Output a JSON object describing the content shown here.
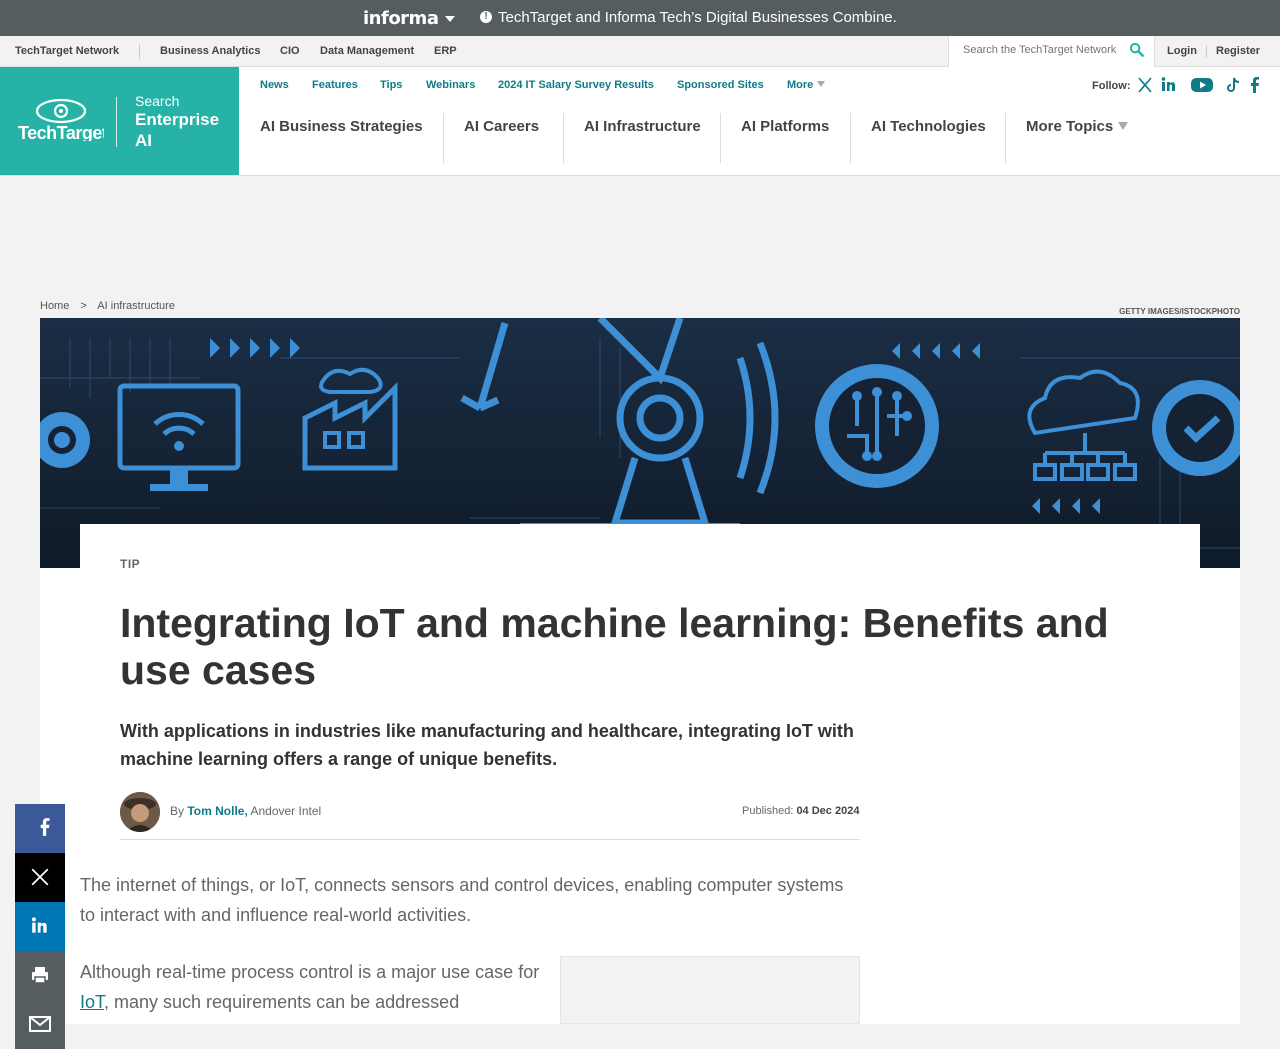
{
  "informa_bar": {
    "logo": "informa",
    "message": "TechTarget and Informa Tech’s Digital Businesses Combine."
  },
  "network_bar": {
    "network_label": "TechTarget Network",
    "links": [
      "Business Analytics",
      "CIO",
      "Data Management",
      "ERP"
    ],
    "search_placeholder": "Search the TechTarget Network",
    "login": "Login",
    "register": "Register"
  },
  "brand": {
    "logo_text": "TechTarget",
    "search_label": "Search",
    "site_name": "Enterprise AI"
  },
  "subnav": {
    "items": [
      "News",
      "Features",
      "Tips",
      "Webinars",
      "2024 IT Salary Survey Results",
      "Sponsored Sites",
      "More"
    ],
    "follow_label": "Follow:"
  },
  "topics": [
    "AI Business Strategies",
    "AI Careers",
    "AI Infrastructure",
    "AI Platforms",
    "AI Technologies",
    "More Topics"
  ],
  "breadcrumb": [
    "Home",
    ">",
    "AI infrastructure"
  ],
  "image_credit": "GETTY IMAGES/ISTOCKPHOTO",
  "article": {
    "kicker": "TIP",
    "title": "Integrating IoT and machine learning: Benefits and use cases",
    "deck": "With applications in industries like manufacturing and healthcare, integrating IoT with machine learning offers a range of unique benefits.",
    "by": "By",
    "author": "Tom Nolle,",
    "affiliation": "Andover Intel",
    "published_label": "Published:",
    "published_date": "04 Dec 2024",
    "p1": "The internet of things, or IoT, connects sensors and control devices, enabling computer systems to interact with and influence real-world activities.",
    "p2_start": "Although real-time process control is a major use case for ",
    "p2_link": "IoT",
    "p2_end": ", many such requirements can be addressed"
  },
  "colors": {
    "brand_teal": "#26b2a6",
    "link_teal": "#0e7c86",
    "informa_gray": "#555d5f",
    "hero_navy": "#142234",
    "hero_blue": "#3d8fd6"
  },
  "share_icons": [
    "facebook-icon",
    "x-icon",
    "linkedin-icon",
    "print-icon",
    "email-icon"
  ]
}
